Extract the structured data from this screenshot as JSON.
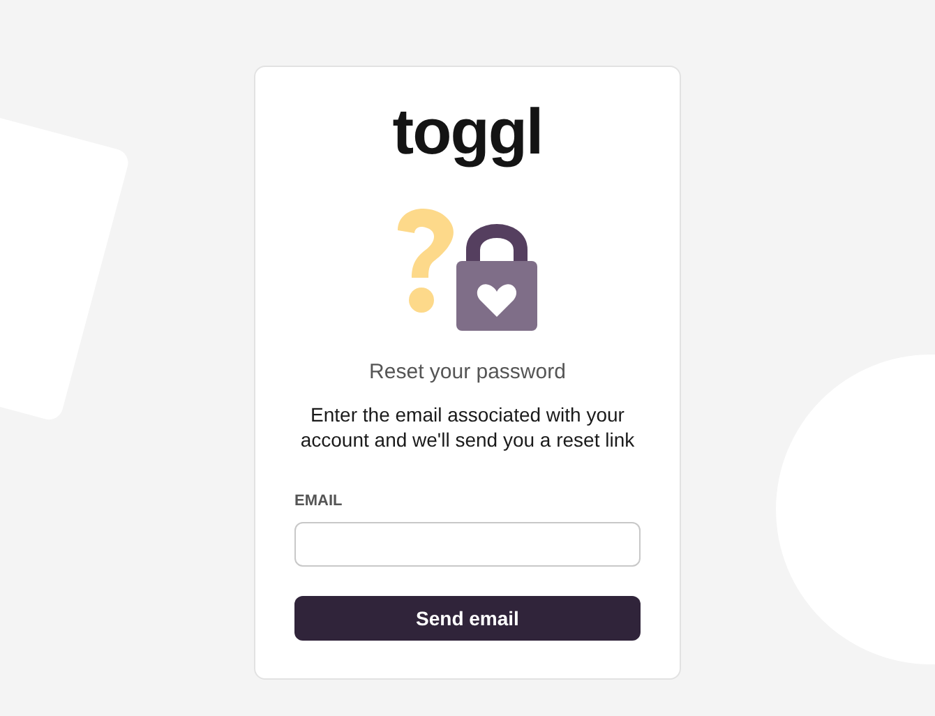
{
  "logo": "toggl",
  "title": "Reset your password",
  "description": "Enter the email associated with your account and we'll send you a reset link",
  "email_field": {
    "label": "EMAIL"
  },
  "submit_button": "Send email"
}
